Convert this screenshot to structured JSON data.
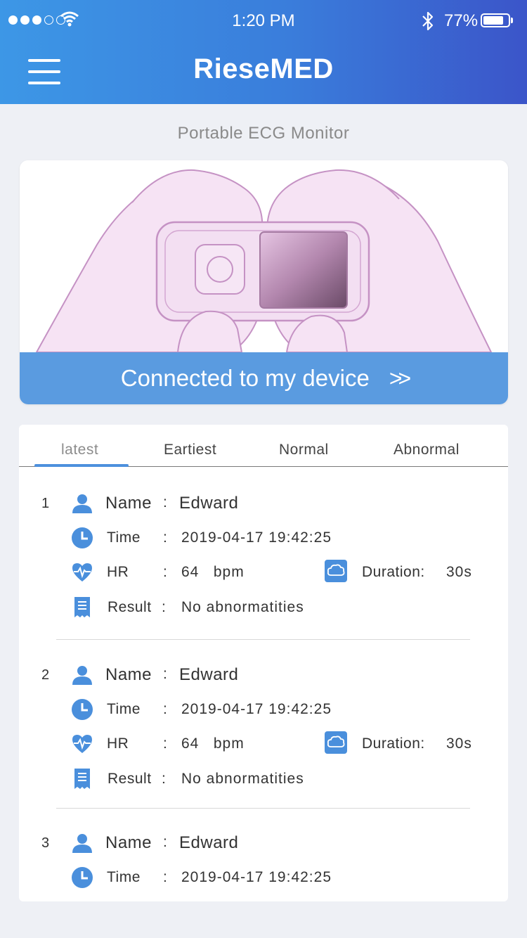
{
  "status_bar": {
    "time": "1:20 PM",
    "battery": "77%"
  },
  "header": {
    "title": "RieseMED"
  },
  "subtitle": "Portable ECG Monitor",
  "device_card": {
    "connect_label": "Connected to my device",
    "connect_arrows": ">>"
  },
  "tabs": [
    {
      "label": "latest"
    },
    {
      "label": "Eartiest"
    },
    {
      "label": "Normal"
    },
    {
      "label": "Abnormal"
    }
  ],
  "field_labels": {
    "name": "Name",
    "time": "Time",
    "hr": "HR",
    "duration": "Duration:",
    "result": "Result",
    "colon": ":"
  },
  "records": [
    {
      "index": "1",
      "name": "Edward",
      "time": "2019-04-17  19:42:25",
      "hr": "64   bpm",
      "duration": "30s",
      "result": "No abnormatities"
    },
    {
      "index": "2",
      "name": "Edward",
      "time": "2019-04-17  19:42:25",
      "hr": "64   bpm",
      "duration": "30s",
      "result": "No abnormatities"
    },
    {
      "index": "3",
      "name": "Edward",
      "time": "2019-04-17  19:42:25"
    }
  ],
  "colors": {
    "header_start": "#3d97e6",
    "header_end": "#3b55c9",
    "accent": "#4d90dd",
    "connect_bar": "#5a9be0",
    "background": "#eef0f5"
  }
}
